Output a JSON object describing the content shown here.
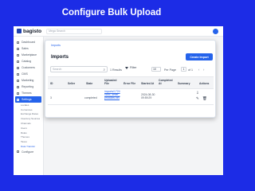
{
  "headline": "Configure Bulk Upload",
  "topbar": {
    "logo_text": "bagisto",
    "search_placeholder": "Mega Search",
    "avatar_initial": ""
  },
  "sidebar": {
    "items": [
      {
        "label": "Dashboard",
        "icon": "dashboard-icon"
      },
      {
        "label": "Sales",
        "icon": "sales-icon"
      },
      {
        "label": "Marketplace",
        "icon": "marketplace-icon"
      },
      {
        "label": "Catalog",
        "icon": "catalog-icon"
      },
      {
        "label": "Customers",
        "icon": "customers-icon"
      },
      {
        "label": "CMS",
        "icon": "cms-icon"
      },
      {
        "label": "Marketing",
        "icon": "marketing-icon"
      },
      {
        "label": "Reporting",
        "icon": "reporting-icon"
      },
      {
        "label": "Themes",
        "icon": "themes-icon"
      },
      {
        "label": "Settings",
        "icon": "settings-icon"
      }
    ],
    "settings_sub": [
      "Locales",
      "Currencies",
      "Exchange Rates",
      "Inventory Sources",
      "Channels",
      "Users",
      "Roles",
      "Themes",
      "Taxes",
      "Data Transfer"
    ],
    "bottom_item": "Configure"
  },
  "panel": {
    "breadcrumb": "Imports",
    "title": "Imports",
    "create_button": "Create Import",
    "search_placeholder": "Search",
    "results": "1 Results",
    "filter_label": "Filter",
    "per_page_value": "10",
    "per_page_label": "Per Page",
    "page_current": "1",
    "page_of": "of 1",
    "prev_icon": "‹",
    "next_icon": "›"
  },
  "table": {
    "headers": [
      "ID",
      "Seller",
      "State",
      "Uploaded File",
      "Error File",
      "Started At",
      "Completed At",
      "Summary",
      "Actions"
    ],
    "rows": [
      {
        "id": "3",
        "seller": "",
        "state": "completed",
        "uploaded_file": "imports/17240855_seller_products.csv",
        "error_file": "",
        "started_at": "2024-08-30 09:59:29",
        "completed_at": "",
        "summary": ""
      }
    ]
  },
  "colors": {
    "background": "#1c2ce6",
    "accent": "#2563eb"
  }
}
